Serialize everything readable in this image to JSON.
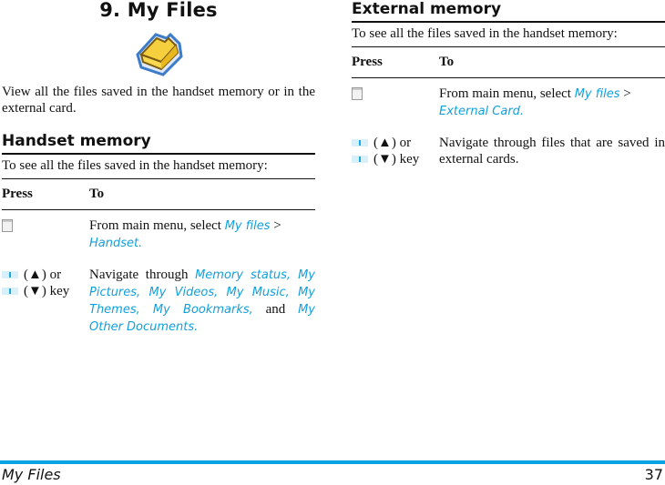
{
  "chapter": {
    "title": "9. My Files",
    "icon": "folder-icon",
    "intro": "View all the files saved in the handset memory or in the external card."
  },
  "handset": {
    "title": "Handset memory",
    "lead": "To see all the files saved in the handset memory:",
    "headers": {
      "press": "Press",
      "to": "To"
    },
    "rows": [
      {
        "press_icon": "softkey-icon",
        "text_pre": "From main menu, select ",
        "link1": "My files",
        "sep": " > ",
        "link2": "Handset."
      },
      {
        "press_icon": "nav-key-icon",
        "press_up": "(▲) or",
        "press_down": "(▼) key",
        "text_pre": "Navigate through ",
        "link1": "Memory status, My Pictures, My Videos, My Music, My Themes, My Bookmarks,",
        "mid": " and ",
        "link2": "My Other Documents."
      }
    ]
  },
  "external": {
    "title": "External memory",
    "lead": "To see all the files saved in the handset memory:",
    "headers": {
      "press": "Press",
      "to": "To"
    },
    "rows": [
      {
        "press_icon": "softkey-icon",
        "text_pre": "From main menu, select ",
        "link1": "My files",
        "sep": " > ",
        "link2": "External Card."
      },
      {
        "press_icon": "nav-key-icon",
        "press_up": "(▲) or",
        "press_down": "(▼) key",
        "text": "Navigate through files that are saved in external cards."
      }
    ]
  },
  "footer": {
    "section": "My Files",
    "page": "37",
    "accent": "#0aa3e6"
  }
}
